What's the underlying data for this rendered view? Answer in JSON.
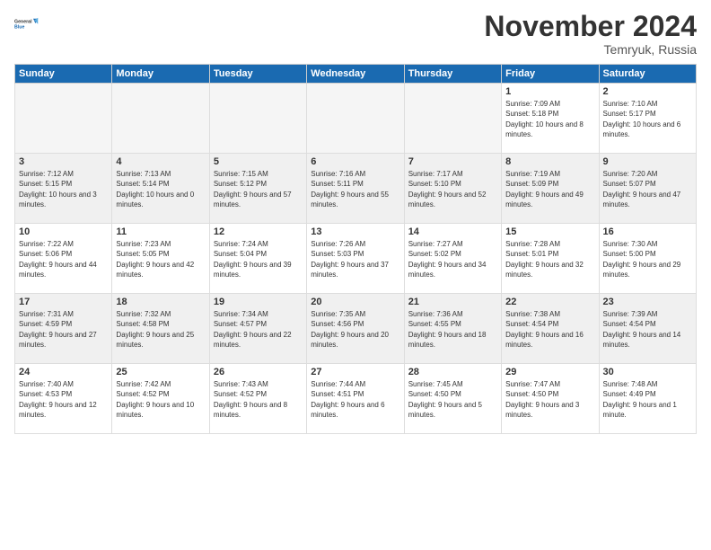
{
  "logo": {
    "text_general": "General",
    "text_blue": "Blue"
  },
  "header": {
    "month_year": "November 2024",
    "location": "Temryuk, Russia"
  },
  "weekdays": [
    "Sunday",
    "Monday",
    "Tuesday",
    "Wednesday",
    "Thursday",
    "Friday",
    "Saturday"
  ],
  "weeks": [
    [
      {
        "day": "",
        "info": ""
      },
      {
        "day": "",
        "info": ""
      },
      {
        "day": "",
        "info": ""
      },
      {
        "day": "",
        "info": ""
      },
      {
        "day": "",
        "info": ""
      },
      {
        "day": "1",
        "info": "Sunrise: 7:09 AM\nSunset: 5:18 PM\nDaylight: 10 hours and 8 minutes."
      },
      {
        "day": "2",
        "info": "Sunrise: 7:10 AM\nSunset: 5:17 PM\nDaylight: 10 hours and 6 minutes."
      }
    ],
    [
      {
        "day": "3",
        "info": "Sunrise: 7:12 AM\nSunset: 5:15 PM\nDaylight: 10 hours and 3 minutes."
      },
      {
        "day": "4",
        "info": "Sunrise: 7:13 AM\nSunset: 5:14 PM\nDaylight: 10 hours and 0 minutes."
      },
      {
        "day": "5",
        "info": "Sunrise: 7:15 AM\nSunset: 5:12 PM\nDaylight: 9 hours and 57 minutes."
      },
      {
        "day": "6",
        "info": "Sunrise: 7:16 AM\nSunset: 5:11 PM\nDaylight: 9 hours and 55 minutes."
      },
      {
        "day": "7",
        "info": "Sunrise: 7:17 AM\nSunset: 5:10 PM\nDaylight: 9 hours and 52 minutes."
      },
      {
        "day": "8",
        "info": "Sunrise: 7:19 AM\nSunset: 5:09 PM\nDaylight: 9 hours and 49 minutes."
      },
      {
        "day": "9",
        "info": "Sunrise: 7:20 AM\nSunset: 5:07 PM\nDaylight: 9 hours and 47 minutes."
      }
    ],
    [
      {
        "day": "10",
        "info": "Sunrise: 7:22 AM\nSunset: 5:06 PM\nDaylight: 9 hours and 44 minutes."
      },
      {
        "day": "11",
        "info": "Sunrise: 7:23 AM\nSunset: 5:05 PM\nDaylight: 9 hours and 42 minutes."
      },
      {
        "day": "12",
        "info": "Sunrise: 7:24 AM\nSunset: 5:04 PM\nDaylight: 9 hours and 39 minutes."
      },
      {
        "day": "13",
        "info": "Sunrise: 7:26 AM\nSunset: 5:03 PM\nDaylight: 9 hours and 37 minutes."
      },
      {
        "day": "14",
        "info": "Sunrise: 7:27 AM\nSunset: 5:02 PM\nDaylight: 9 hours and 34 minutes."
      },
      {
        "day": "15",
        "info": "Sunrise: 7:28 AM\nSunset: 5:01 PM\nDaylight: 9 hours and 32 minutes."
      },
      {
        "day": "16",
        "info": "Sunrise: 7:30 AM\nSunset: 5:00 PM\nDaylight: 9 hours and 29 minutes."
      }
    ],
    [
      {
        "day": "17",
        "info": "Sunrise: 7:31 AM\nSunset: 4:59 PM\nDaylight: 9 hours and 27 minutes."
      },
      {
        "day": "18",
        "info": "Sunrise: 7:32 AM\nSunset: 4:58 PM\nDaylight: 9 hours and 25 minutes."
      },
      {
        "day": "19",
        "info": "Sunrise: 7:34 AM\nSunset: 4:57 PM\nDaylight: 9 hours and 22 minutes."
      },
      {
        "day": "20",
        "info": "Sunrise: 7:35 AM\nSunset: 4:56 PM\nDaylight: 9 hours and 20 minutes."
      },
      {
        "day": "21",
        "info": "Sunrise: 7:36 AM\nSunset: 4:55 PM\nDaylight: 9 hours and 18 minutes."
      },
      {
        "day": "22",
        "info": "Sunrise: 7:38 AM\nSunset: 4:54 PM\nDaylight: 9 hours and 16 minutes."
      },
      {
        "day": "23",
        "info": "Sunrise: 7:39 AM\nSunset: 4:54 PM\nDaylight: 9 hours and 14 minutes."
      }
    ],
    [
      {
        "day": "24",
        "info": "Sunrise: 7:40 AM\nSunset: 4:53 PM\nDaylight: 9 hours and 12 minutes."
      },
      {
        "day": "25",
        "info": "Sunrise: 7:42 AM\nSunset: 4:52 PM\nDaylight: 9 hours and 10 minutes."
      },
      {
        "day": "26",
        "info": "Sunrise: 7:43 AM\nSunset: 4:52 PM\nDaylight: 9 hours and 8 minutes."
      },
      {
        "day": "27",
        "info": "Sunrise: 7:44 AM\nSunset: 4:51 PM\nDaylight: 9 hours and 6 minutes."
      },
      {
        "day": "28",
        "info": "Sunrise: 7:45 AM\nSunset: 4:50 PM\nDaylight: 9 hours and 5 minutes."
      },
      {
        "day": "29",
        "info": "Sunrise: 7:47 AM\nSunset: 4:50 PM\nDaylight: 9 hours and 3 minutes."
      },
      {
        "day": "30",
        "info": "Sunrise: 7:48 AM\nSunset: 4:49 PM\nDaylight: 9 hours and 1 minute."
      }
    ]
  ]
}
